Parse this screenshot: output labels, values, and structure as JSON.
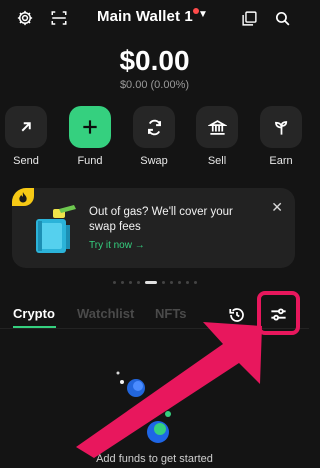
{
  "header": {
    "wallet_name": "Main Wallet 1",
    "icons": [
      "gear-icon",
      "scan-icon",
      "copy-icon",
      "search-icon"
    ]
  },
  "balance": {
    "amount": "$0.00",
    "change": "$0.00 (0.00%)"
  },
  "actions": [
    {
      "label": "Send",
      "icon": "arrow-up-right-icon"
    },
    {
      "label": "Fund",
      "icon": "plus-icon"
    },
    {
      "label": "Swap",
      "icon": "swap-icon"
    },
    {
      "label": "Sell",
      "icon": "bank-icon"
    },
    {
      "label": "Earn",
      "icon": "sprout-icon"
    }
  ],
  "promo": {
    "title": "Out of gas? We'll cover your swap fees",
    "cta": "Try it now →"
  },
  "tabs": [
    {
      "label": "Crypto",
      "active": true
    },
    {
      "label": "Watchlist",
      "active": false
    },
    {
      "label": "NFTs",
      "active": false
    }
  ],
  "empty_state": {
    "text": "Add funds to get started"
  },
  "colors": {
    "background": "#141414",
    "accent": "#35d07f",
    "highlight": "#e8175d",
    "badge": "#f6c915"
  }
}
